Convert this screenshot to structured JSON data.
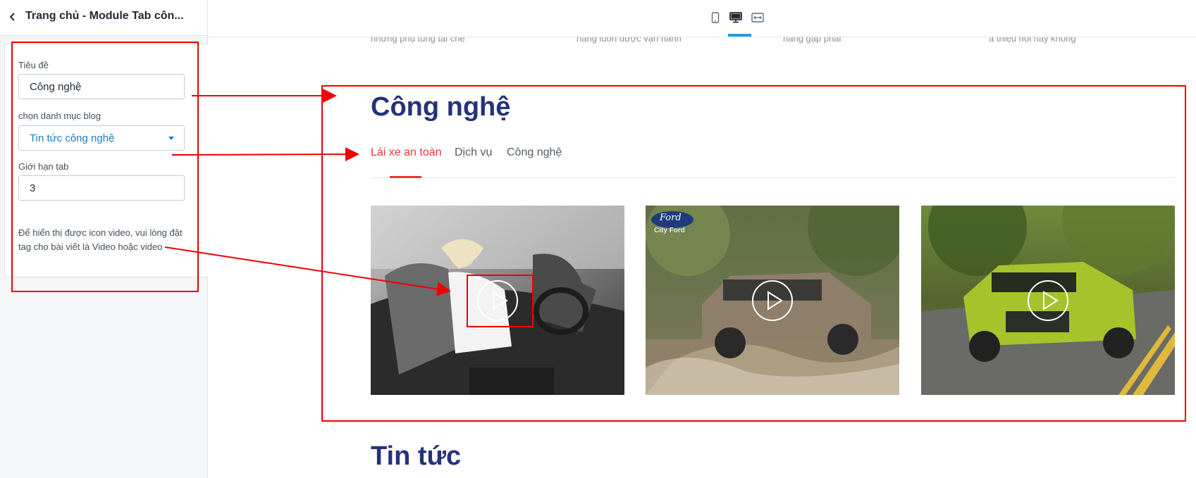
{
  "sidebar": {
    "title": "Trang chủ - Module Tab côn...",
    "fields": {
      "title_label": "Tiêu đề",
      "title_value": "Công nghệ",
      "category_label": "chọn danh mục blog",
      "category_value": "Tin tức công nghệ",
      "limit_label": "Giới hạn tab",
      "limit_value": "3"
    },
    "help_text": "Để hiển thị được icon video, vui lòng đặt tag cho bài viết là Video hoặc video"
  },
  "toolbar": {
    "views": [
      {
        "icon": "mobile-icon"
      },
      {
        "icon": "desktop-icon",
        "active": true
      },
      {
        "icon": "fullwidth-icon"
      }
    ]
  },
  "preview": {
    "previous_section_snippets": [
      "những phụ tùng tái chế",
      "năng luôn được vận hành",
      "hàng gặp phải",
      "a thiệu nói này không"
    ],
    "section_title": "Công nghệ",
    "tabs": [
      {
        "label": "Lái xe an toàn",
        "active": true
      },
      {
        "label": "Dịch vụ",
        "active": false
      },
      {
        "label": "Công nghệ",
        "active": false
      }
    ],
    "cards": [
      {
        "image": "woman driving convertible car",
        "icon": "play-icon"
      },
      {
        "image": "Ford SUV driving through water",
        "icon": "play-icon",
        "logo_text": "Ford",
        "logo_subtext": "City Ford"
      },
      {
        "image": "green Hyundai SUV on road",
        "icon": "play-icon"
      }
    ],
    "next_section_title": "Tin tức"
  },
  "colors": {
    "annotation": "#f00000",
    "accent_blue": "#1a7ec2",
    "active_tab": "#e53935",
    "heading": "#25327a"
  }
}
